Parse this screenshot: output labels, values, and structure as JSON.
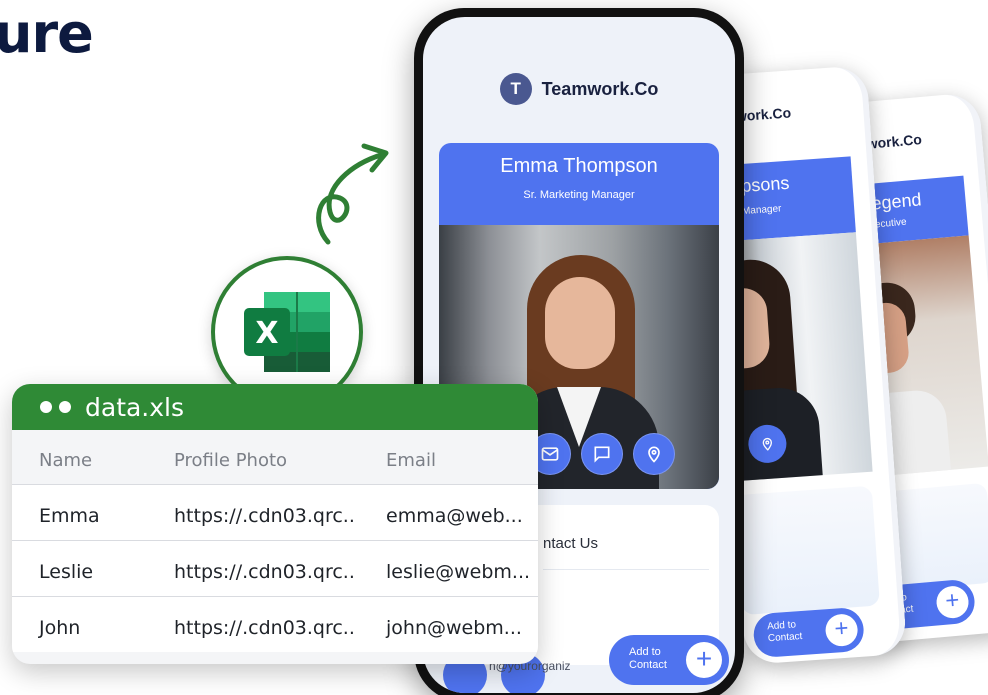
{
  "headline": "ure",
  "brand": {
    "name": "Teamwork.Co",
    "logo_letter": "T"
  },
  "main_card": {
    "name": "Emma Thompson",
    "title": "Sr. Marketing Manager",
    "icons": [
      "mail-icon",
      "chat-icon",
      "location-icon"
    ]
  },
  "contact": {
    "title": "ntact Us",
    "email_snippet": "n@yourorganiz",
    "add_label_line1": "Add to",
    "add_label_line2": "Contact",
    "plus": "+"
  },
  "back_card_1": {
    "brand": "mwork.Co",
    "name": "mpsons",
    "title": "ng Manager",
    "add_line1": "Add to",
    "add_line2": "Contact"
  },
  "back_card_2": {
    "brand": "mwork.Co",
    "name": "Legend",
    "title": "Executive",
    "add_line1": "Add to",
    "add_line2": "Contact"
  },
  "spreadsheet": {
    "title": "data.xls",
    "columns": [
      "Name",
      "Profile Photo",
      "Email"
    ],
    "rows": [
      [
        "Emma",
        "https://.cdn03.qrc..",
        "emma@web..."
      ],
      [
        "Leslie",
        "https://.cdn03.qrc..",
        "leslie@webm..."
      ],
      [
        "John",
        "https://.cdn03.qrc..",
        "john@webm..."
      ]
    ]
  },
  "excel_badge_letter": "X",
  "colors": {
    "accent": "#4f73ef",
    "excel_green": "#2f8a36",
    "navy": "#0d1a3f"
  }
}
